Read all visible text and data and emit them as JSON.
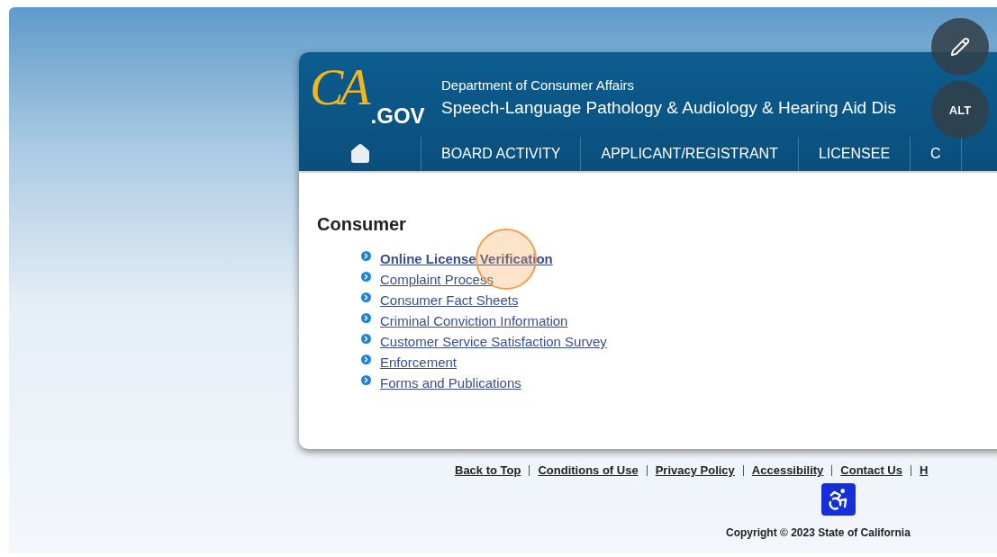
{
  "logo": {
    "script": "CA",
    "suffix": ".GOV"
  },
  "header": {
    "department": "Department of Consumer Affairs",
    "board": "Speech-Language Pathology & Audiology & Hearing Aid Dis"
  },
  "nav": [
    {
      "label": "BOARD ACTIVITY"
    },
    {
      "label": "APPLICANT/REGISTRANT"
    },
    {
      "label": "LICENSEE"
    },
    {
      "label": "C"
    }
  ],
  "section": {
    "title": "Consumer",
    "links": [
      {
        "label": "Online License Verification",
        "selected": true
      },
      {
        "label": "Complaint Process",
        "selected": false
      },
      {
        "label": "Consumer Fact Sheets",
        "selected": false
      },
      {
        "label": "Criminal Conviction Information",
        "selected": false
      },
      {
        "label": "Customer Service Satisfaction Survey",
        "selected": false
      },
      {
        "label": "Enforcement",
        "selected": false
      },
      {
        "label": "Forms and Publications",
        "selected": false
      }
    ]
  },
  "footer": {
    "links": [
      "Back to Top",
      "Conditions of Use",
      "Privacy Policy",
      "Accessibility",
      "Contact Us",
      "H"
    ],
    "copyright": "Copyright © 2023 State of California"
  },
  "overlay": {
    "alt_button": "ALT"
  }
}
